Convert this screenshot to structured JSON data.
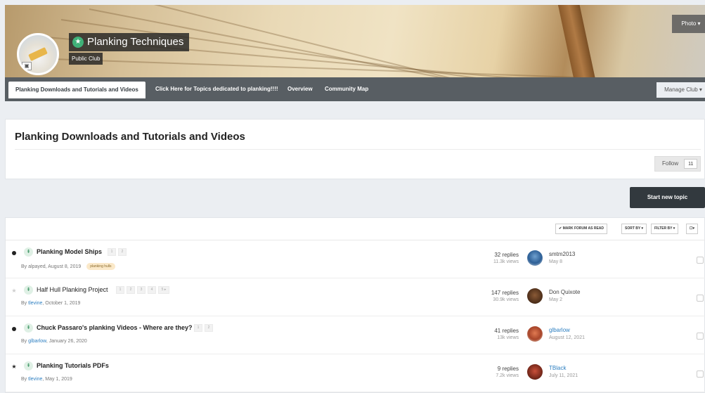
{
  "club": {
    "title": "Planking Techniques",
    "subtitle": "Public Club",
    "photo_button": "Photo ▾"
  },
  "nav": {
    "items": [
      "Planking Downloads and Tutorials and Videos",
      "Click Here for Topics dedicated to planking!!!!",
      "Overview",
      "Community Map"
    ],
    "manage_button": "Manage Club ▾"
  },
  "forum": {
    "title": "Planking Downloads and Tutorials and Videos",
    "follow_label": "Follow",
    "follow_count": "11",
    "start_topic": "Start new topic"
  },
  "toolbar": {
    "mark_read": "✔ MARK FORUM AS READ",
    "sort_by": "SORT BY ▾",
    "filter_by": "FILTER BY ▾",
    "select": "☐▾"
  },
  "topics": [
    {
      "title": "Planking Model Ships",
      "pages": [
        "1",
        "2"
      ],
      "by": "By ",
      "author": "alpayed",
      "date": ", August 8, 2019",
      "tag": "planking hulls",
      "replies": "32 replies",
      "views": "11.3k views",
      "last_user": "smtm2013",
      "last_date": "May 8"
    },
    {
      "title": "Half Hull Planking Project",
      "pages": [
        "1",
        "2",
        "3",
        "4",
        "5 ▸"
      ],
      "by": "By ",
      "author": "tlevine",
      "date": ", October 1, 2019",
      "tag": "",
      "replies": "147 replies",
      "views": "30.9k views",
      "last_user": "Don Quixote",
      "last_date": "May 2"
    },
    {
      "title": "Chuck Passaro's planking Videos - Where are they?",
      "pages": [
        "1",
        "2"
      ],
      "by": "By ",
      "author": "glbarlow",
      "date": ", January 26, 2020",
      "tag": "",
      "replies": "41 replies",
      "views": "13k views",
      "last_user": "glbarlow",
      "last_date": "August 12, 2021"
    },
    {
      "title": "Planking Tutorials PDFs",
      "pages": [],
      "by": "By ",
      "author": "tlevine",
      "date": ", May 1, 2019",
      "tag": "",
      "replies": "9 replies",
      "views": "7.2k views",
      "last_user": "TBlack",
      "last_date": "July 11, 2021"
    }
  ],
  "colors": {
    "nav_bg": "#585e63",
    "button_dark": "#32393e",
    "link": "#2d7fc1",
    "pin_green": "#2c8a55"
  }
}
